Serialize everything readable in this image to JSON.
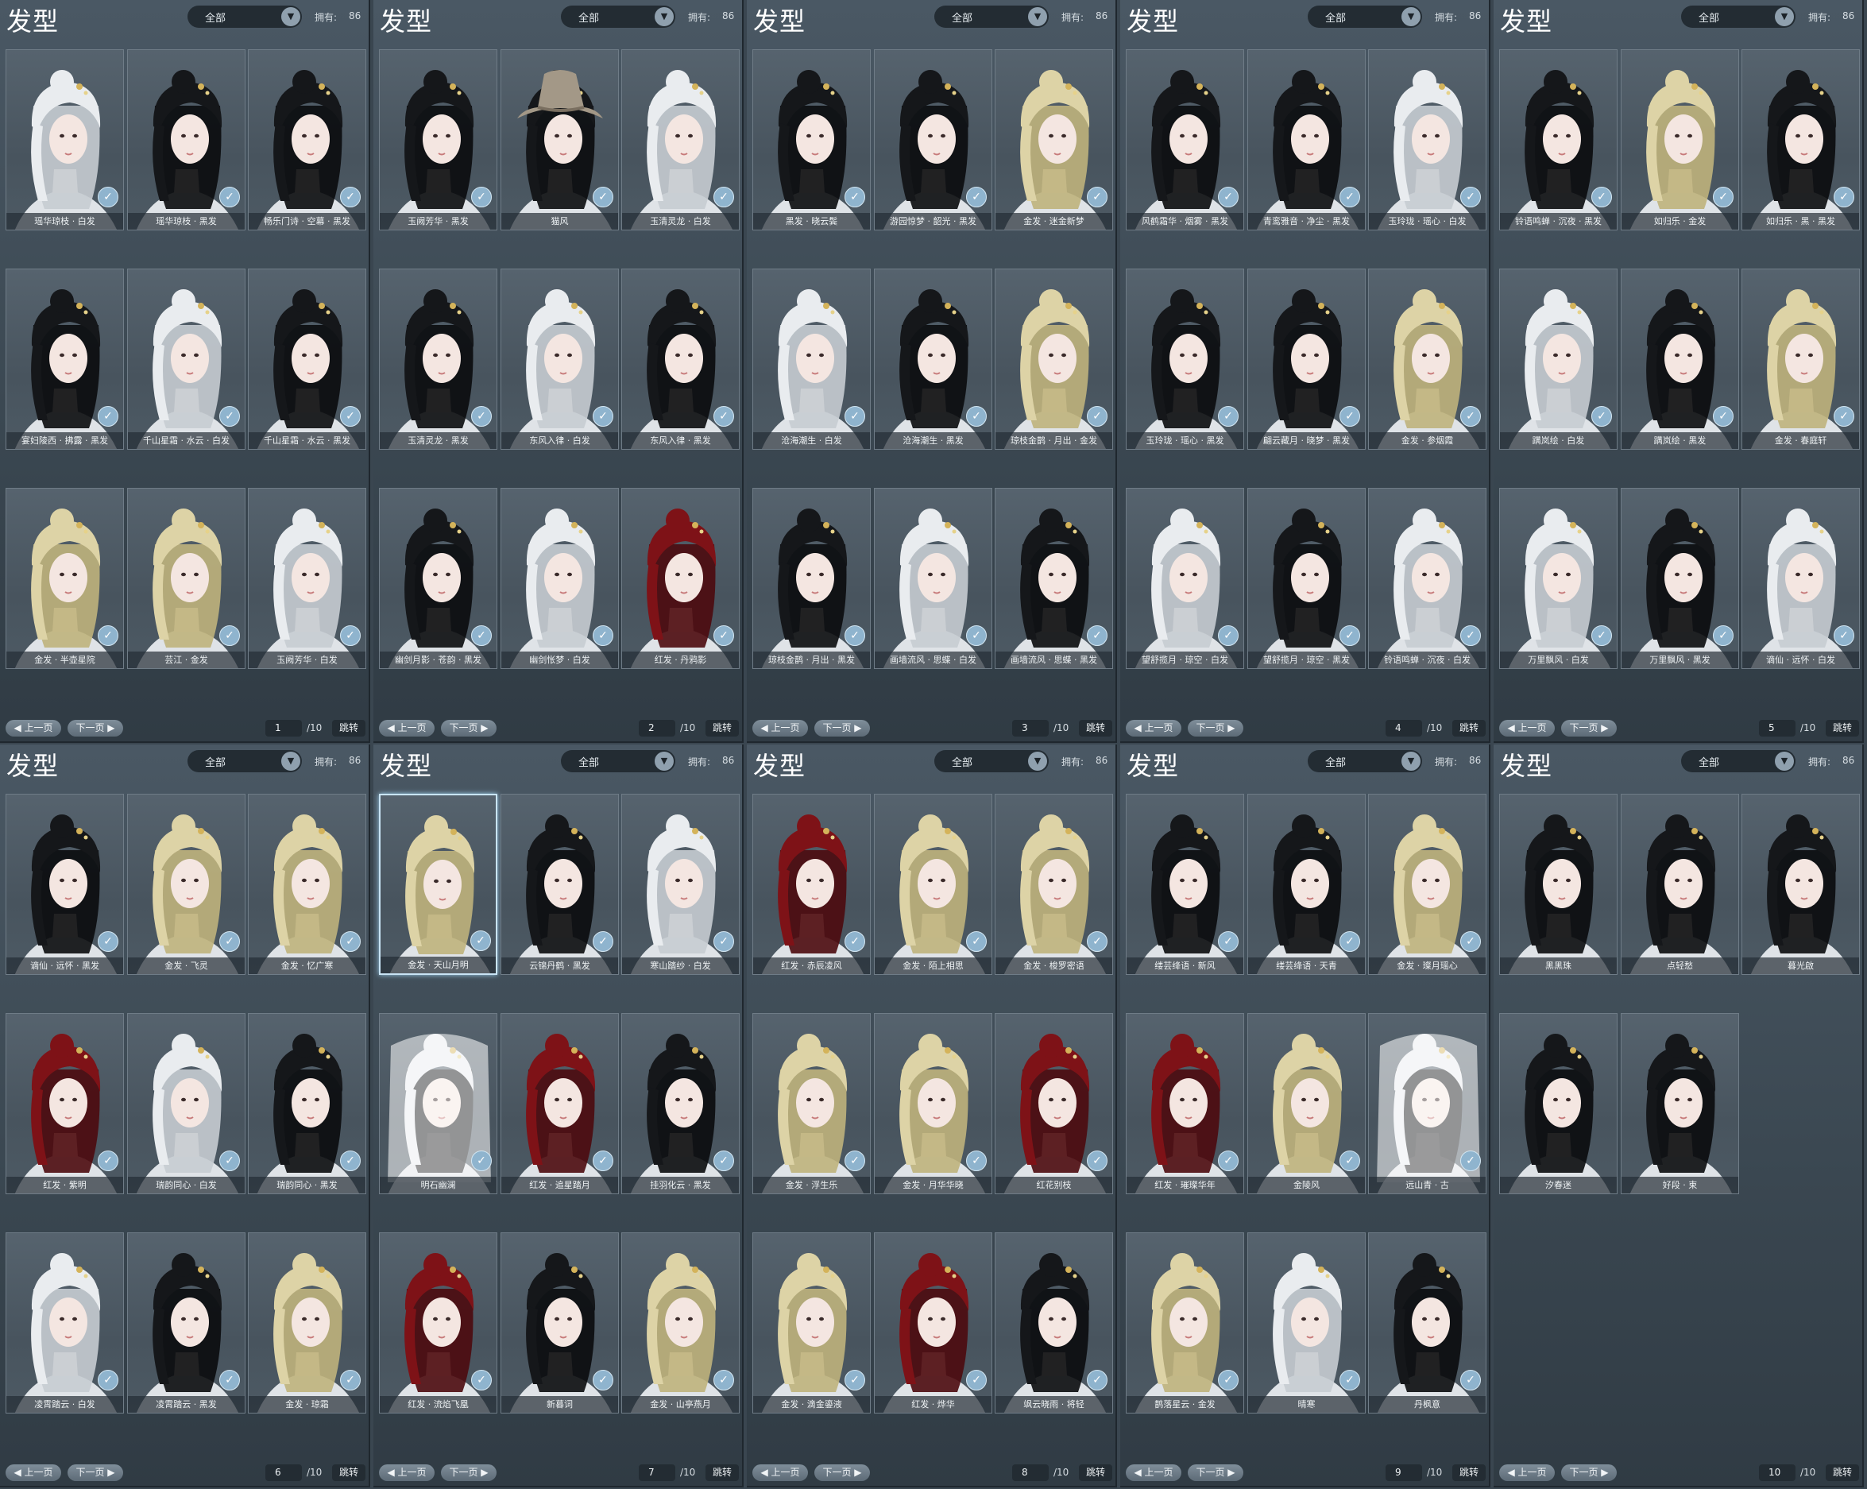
{
  "title": "发型",
  "filter_value": "全部",
  "owned_label": "拥有:",
  "owned_count": "86",
  "prev_label": "上一页",
  "next_label": "下一页",
  "jump_label": "跳转",
  "page_total": "/10",
  "colors": {
    "white": "#e9ecef",
    "black": "#15171a",
    "blonde": "#ddd3a6",
    "red": "#7e1217",
    "hat": "#a39887",
    "accent_check": "#8fb4ce"
  },
  "pages": [
    {
      "page": "1",
      "items": [
        {
          "name": "瑶华琼枝 · 白发",
          "hair": "white"
        },
        {
          "name": "瑶华琼枝 · 黑发",
          "hair": "black"
        },
        {
          "name": "畅乐门诗 · 空幕 · 黑发",
          "hair": "black"
        },
        {
          "name": "宴妇陵西 · 拂露 · 黑发",
          "hair": "black"
        },
        {
          "name": "千山星霜 · 水云 · 白发",
          "hair": "white"
        },
        {
          "name": "千山星霜 · 水云 · 黑发",
          "hair": "black"
        },
        {
          "name": "金发 · 半壶星院",
          "hair": "blonde"
        },
        {
          "name": "芸江 · 金发",
          "hair": "blonde"
        },
        {
          "name": "玉阙芳华 · 白发",
          "hair": "white"
        }
      ]
    },
    {
      "page": "2",
      "items": [
        {
          "name": "玉阙芳华 · 黑发",
          "hair": "black"
        },
        {
          "name": "猫风",
          "hair": "hat"
        },
        {
          "name": "玉清灵龙 · 白发",
          "hair": "white"
        },
        {
          "name": "玉清灵龙 · 黑发",
          "hair": "black"
        },
        {
          "name": "东风入律 · 白发",
          "hair": "white"
        },
        {
          "name": "东风入律 · 黑发",
          "hair": "black"
        },
        {
          "name": "幽剑月影 · 苍韵 · 黑发",
          "hair": "black"
        },
        {
          "name": "幽剑怅梦 · 白发",
          "hair": "white"
        },
        {
          "name": "红发 · 丹鸦影",
          "hair": "red"
        }
      ]
    },
    {
      "page": "3",
      "items": [
        {
          "name": "黑发 · 晓云鬓",
          "hair": "black"
        },
        {
          "name": "游园惊梦 · 韶光 · 黑发",
          "hair": "black"
        },
        {
          "name": "金发 · 迷金新梦",
          "hair": "blonde"
        },
        {
          "name": "沧海潮生 · 白发",
          "hair": "white"
        },
        {
          "name": "沧海潮生 · 黑发",
          "hair": "black"
        },
        {
          "name": "琼枝金鹊 · 月出 · 金发",
          "hair": "blonde"
        },
        {
          "name": "琼枝金鹊 · 月出 · 黑发",
          "hair": "black"
        },
        {
          "name": "画墙流风 · 思蝶 · 白发",
          "hair": "white"
        },
        {
          "name": "画墙流风 · 思蝶 · 黑发",
          "hair": "black"
        }
      ]
    },
    {
      "page": "4",
      "items": [
        {
          "name": "风鹤霜华 · 烟雾 · 黑发",
          "hair": "black"
        },
        {
          "name": "青鸾雅音 · 净尘 · 黑发",
          "hair": "black"
        },
        {
          "name": "玉玲珑 · 瑶心 · 白发",
          "hair": "white"
        },
        {
          "name": "玉玲珑 · 瑶心 · 黑发",
          "hair": "black"
        },
        {
          "name": "翩云藏月 · 晓梦 · 黑发",
          "hair": "black"
        },
        {
          "name": "金发 · 参烟霞",
          "hair": "blonde"
        },
        {
          "name": "望舒揽月 · 琼空 · 白发",
          "hair": "white"
        },
        {
          "name": "望舒揽月 · 琼空 · 黑发",
          "hair": "black"
        },
        {
          "name": "铃语鸣蝉 · 沉夜 · 白发",
          "hair": "white"
        }
      ]
    },
    {
      "page": "5",
      "items": [
        {
          "name": "铃语鸣蝉 · 沉夜 · 黑发",
          "hair": "black"
        },
        {
          "name": "如归乐 · 金发",
          "hair": "blonde"
        },
        {
          "name": "如归乐 · 黑 · 黑发",
          "hair": "black"
        },
        {
          "name": "蹒岚绘 · 白发",
          "hair": "white"
        },
        {
          "name": "蹒岚绘 · 黑发",
          "hair": "black"
        },
        {
          "name": "金发 · 春庭轩",
          "hair": "blonde"
        },
        {
          "name": "万里飘风 · 白发",
          "hair": "white"
        },
        {
          "name": "万里飘风 · 黑发",
          "hair": "black"
        },
        {
          "name": "谪仙 · 远怀 · 白发",
          "hair": "white"
        }
      ]
    },
    {
      "page": "6",
      "items": [
        {
          "name": "谪仙 · 远怀 · 黑发",
          "hair": "black"
        },
        {
          "name": "金发 · 飞灵",
          "hair": "blonde"
        },
        {
          "name": "金发 · 忆广寒",
          "hair": "blonde"
        },
        {
          "name": "红发 · 紫明",
          "hair": "red"
        },
        {
          "name": "瑞韵同心 · 白发",
          "hair": "white"
        },
        {
          "name": "瑞韵同心 · 黑发",
          "hair": "black"
        },
        {
          "name": "凌霄踏云 · 白发",
          "hair": "white"
        },
        {
          "name": "凌霄踏云 · 黑发",
          "hair": "black"
        },
        {
          "name": "金发 · 琼霜",
          "hair": "blonde"
        }
      ]
    },
    {
      "page": "7",
      "items": [
        {
          "name": "金发 · 天山月明",
          "hair": "blonde",
          "selected": true
        },
        {
          "name": "云锦丹鹤 · 黑发",
          "hair": "black"
        },
        {
          "name": "寒山踏纱 · 白发",
          "hair": "white"
        },
        {
          "name": "明石幽澜",
          "hair": "veil"
        },
        {
          "name": "红发 · 追星踏月",
          "hair": "red"
        },
        {
          "name": "挂羽化云 · 黑发",
          "hair": "black"
        },
        {
          "name": "红发 · 流焰飞凰",
          "hair": "red"
        },
        {
          "name": "新暮词",
          "hair": "black"
        },
        {
          "name": "金发 · 山亭燕月",
          "hair": "blonde"
        }
      ]
    },
    {
      "page": "8",
      "items": [
        {
          "name": "红发 · 赤辰凌风",
          "hair": "red"
        },
        {
          "name": "金发 · 陌上相思",
          "hair": "blonde"
        },
        {
          "name": "金发 · 梭罗密语",
          "hair": "blonde"
        },
        {
          "name": "金发 · 浮生乐",
          "hair": "blonde"
        },
        {
          "name": "金发 · 月华华晓",
          "hair": "blonde"
        },
        {
          "name": "红花别枝",
          "hair": "red"
        },
        {
          "name": "金发 · 滴金鎏液",
          "hair": "blonde"
        },
        {
          "name": "红发 · 烨华",
          "hair": "red"
        },
        {
          "name": "飒云晓雨 · 将轻",
          "hair": "black"
        }
      ]
    },
    {
      "page": "9",
      "items": [
        {
          "name": "缕芸绛语 · 新风",
          "hair": "black"
        },
        {
          "name": "缕芸绛语 · 天青",
          "hair": "black"
        },
        {
          "name": "金发 · 璨月瑶心",
          "hair": "blonde"
        },
        {
          "name": "红发 · 璀璨华年",
          "hair": "red"
        },
        {
          "name": "金陵风",
          "hair": "blonde"
        },
        {
          "name": "远山青 · 古",
          "hair": "veil"
        },
        {
          "name": "鹊落星云 · 金发",
          "hair": "blonde"
        },
        {
          "name": "晴寒",
          "hair": "white"
        },
        {
          "name": "丹枫意",
          "hair": "black"
        }
      ]
    },
    {
      "page": "10",
      "items": [
        {
          "name": "黑黑珠",
          "hair": "black"
        },
        {
          "name": "点轻愁",
          "hair": "black"
        },
        {
          "name": "暮光啟",
          "hair": "black"
        },
        {
          "name": "汐春迷",
          "hair": "black"
        },
        {
          "name": "好段 · 束",
          "hair": "black"
        }
      ]
    }
  ]
}
